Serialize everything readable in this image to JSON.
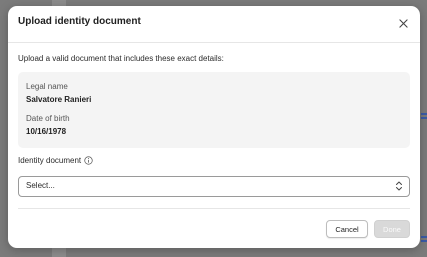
{
  "dialog": {
    "title": "Upload identity document",
    "intro": "Upload a valid document that includes these exact details:",
    "details": {
      "legal_name_label": "Legal name",
      "legal_name_value": "Salvatore Ranieri",
      "dob_label": "Date of birth",
      "dob_value": "10/16/1978"
    },
    "field": {
      "label": "Identity document",
      "info_icon": "info-icon",
      "select_value": "Select..."
    },
    "buttons": {
      "cancel": "Cancel",
      "done": "Done"
    }
  },
  "colors": {
    "backdrop": "#7b7b7b",
    "done_disabled": "#d9d9d9"
  }
}
